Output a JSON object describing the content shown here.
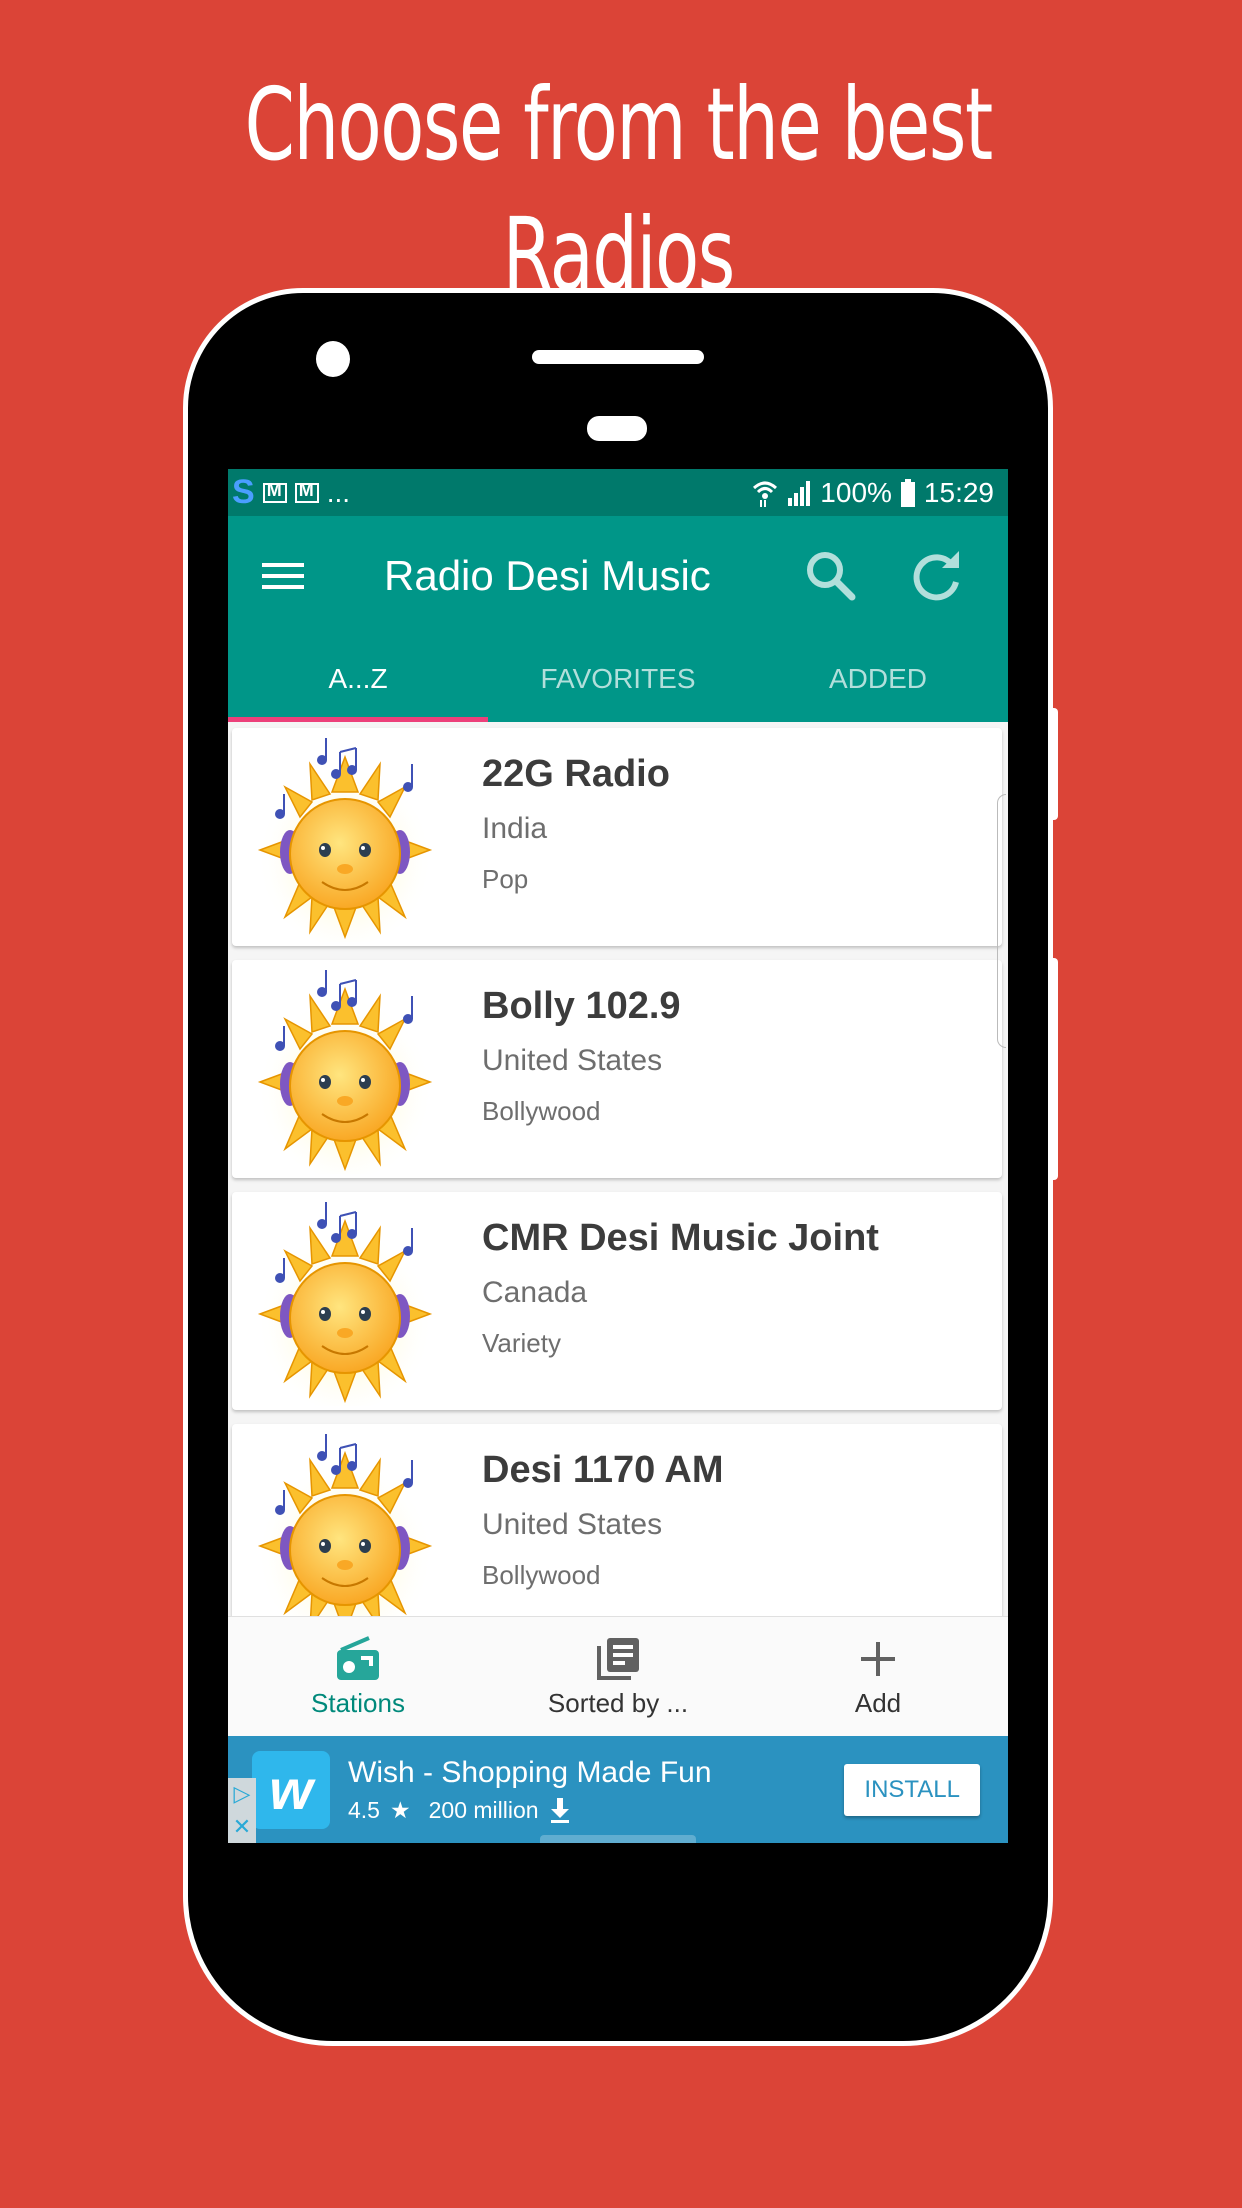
{
  "promo": {
    "headline": "Choose from the best Radios"
  },
  "status_bar": {
    "notification_icons": [
      "s-app-icon",
      "gmail-stack-icon",
      "gmail-icon"
    ],
    "more": "...",
    "battery": "100%",
    "time": "15:29"
  },
  "app_bar": {
    "title": "Radio Desi Music",
    "menu_icon": "hamburger-icon",
    "search_icon": "search-icon",
    "refresh_icon": "refresh-icon"
  },
  "tabs": [
    {
      "label": "A...Z",
      "active": true
    },
    {
      "label": "FAVORITES",
      "active": false
    },
    {
      "label": "ADDED",
      "active": false
    }
  ],
  "stations": [
    {
      "name": "22G Radio",
      "country": "India",
      "genre": "Pop",
      "logo": "sun-headphones-logo"
    },
    {
      "name": "Bolly 102.9",
      "country": "United States",
      "genre": "Bollywood",
      "logo": "sun-headphones-logo"
    },
    {
      "name": "CMR Desi Music Joint",
      "country": "Canada",
      "genre": "Variety",
      "logo": "sun-headphones-logo"
    },
    {
      "name": "Desi 1170 AM",
      "country": "United States",
      "genre": "Bollywood",
      "logo": "sun-headphones-logo"
    }
  ],
  "bottom_nav": [
    {
      "label": "Stations",
      "icon": "radio-icon",
      "active": true
    },
    {
      "label": "Sorted by ...",
      "icon": "library-books-icon",
      "active": false
    },
    {
      "label": "Add",
      "icon": "plus-icon",
      "active": false
    }
  ],
  "ad": {
    "app_name": "Wish - Shopping Made Fun",
    "rating": "4.5",
    "downloads": "200 million",
    "button": "INSTALL",
    "logo_letter": "w"
  },
  "colors": {
    "background": "#db4437",
    "primary": "#009688",
    "primary_dark": "#00796b",
    "accent": "#ec407a",
    "ad_background": "#2b92c0"
  }
}
